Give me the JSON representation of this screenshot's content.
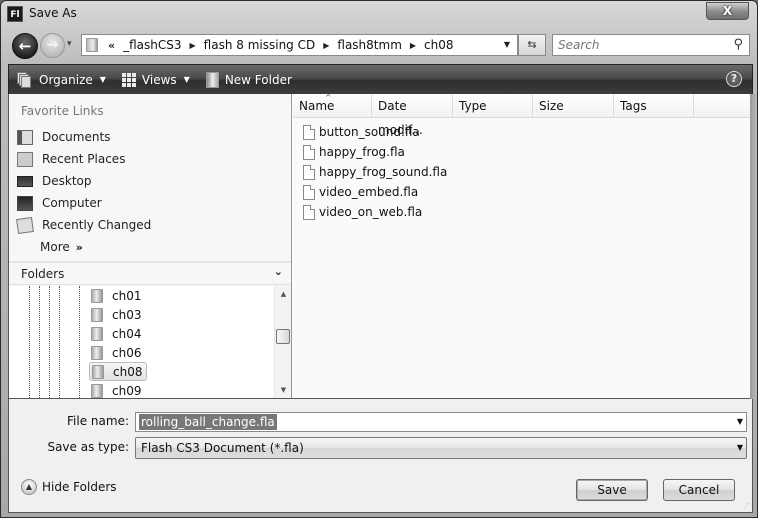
{
  "window": {
    "app_icon_text": "Fl",
    "title": "Save As",
    "close_label": "X"
  },
  "navigation": {
    "back_glyph": "←",
    "forward_glyph": "→",
    "recent_glyph": "▾",
    "overflow_glyph": "«",
    "breadcrumb": [
      "_flashCS3",
      "flash 8 missing CD",
      "flash8tmm",
      "ch08"
    ],
    "separator_glyph": "▶",
    "dropdown_glyph": "▼",
    "refresh_glyph": "⇆",
    "search_placeholder": "Search",
    "search_value": "",
    "search_glyph": "⚲"
  },
  "toolbar": {
    "organize_label": "Organize",
    "views_label": "Views",
    "new_folder_label": "New Folder",
    "caret_glyph": "▼",
    "help_glyph": "?"
  },
  "sidebar": {
    "favorites_header": "Favorite Links",
    "favorites": [
      {
        "label": "Documents",
        "icon": "documents-icon"
      },
      {
        "label": "Recent Places",
        "icon": "recent-places-icon"
      },
      {
        "label": "Desktop",
        "icon": "desktop-icon"
      },
      {
        "label": "Computer",
        "icon": "computer-icon"
      },
      {
        "label": "Recently Changed",
        "icon": "recently-changed-icon"
      }
    ],
    "more_label": "More",
    "more_glyph": "»",
    "folders_header": "Folders",
    "folders_collapse_glyph": "⌄",
    "folder_tree": [
      {
        "label": "ch01",
        "selected": false
      },
      {
        "label": "ch03",
        "selected": false
      },
      {
        "label": "ch04",
        "selected": false
      },
      {
        "label": "ch06",
        "selected": false
      },
      {
        "label": "ch08",
        "selected": true
      },
      {
        "label": "ch09",
        "selected": false
      }
    ],
    "scroll_up_glyph": "▲",
    "scroll_down_glyph": "▼"
  },
  "file_list": {
    "columns": [
      "Name",
      "Date modif...",
      "Type",
      "Size",
      "Tags"
    ],
    "sort_glyph": "^",
    "files": [
      "button_sound.fla",
      "happy_frog.fla",
      "happy_frog_sound.fla",
      "video_embed.fla",
      "video_on_web.fla"
    ]
  },
  "form": {
    "filename_label": "File name:",
    "filename_value": "rolling_ball_change.fla",
    "savetype_label": "Save as type:",
    "savetype_value": "Flash CS3 Document (*.fla)",
    "dropdown_glyph": "▼"
  },
  "footer": {
    "hide_folders_label": "Hide Folders",
    "hide_folders_glyph": "▲",
    "save_label": "Save",
    "cancel_label": "Cancel",
    "grip_glyph": "⋰"
  }
}
